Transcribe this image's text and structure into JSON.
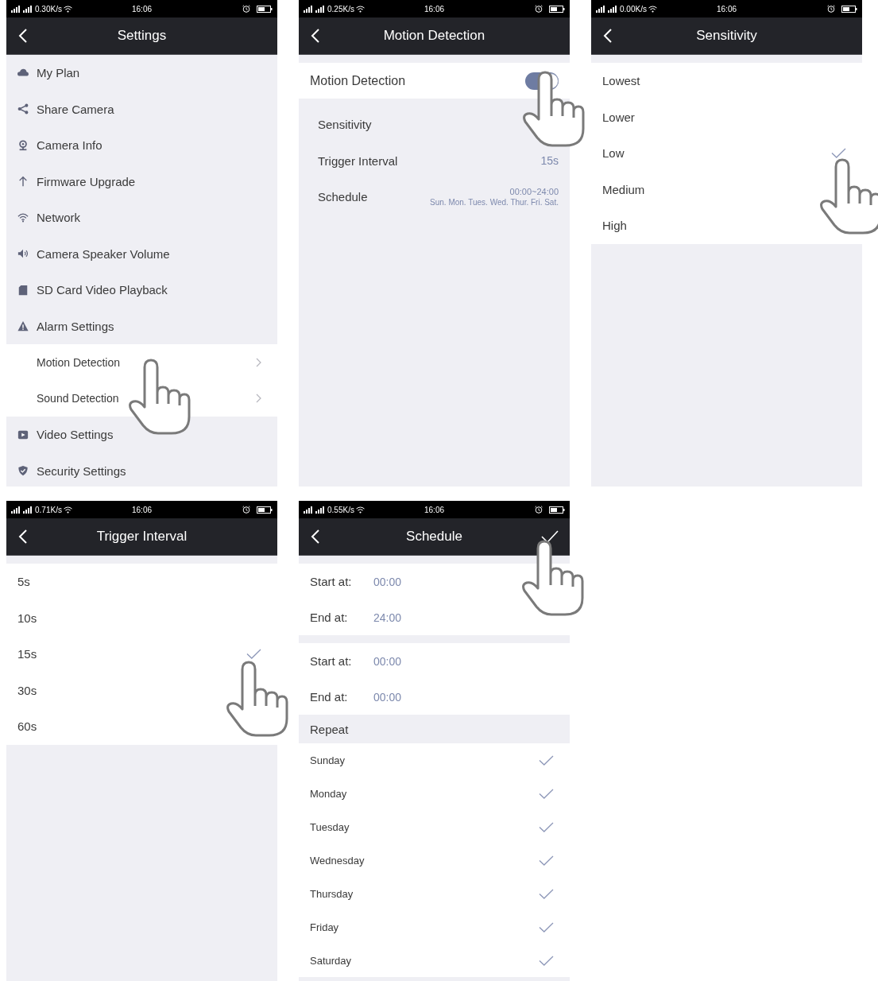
{
  "screens": [
    {
      "kind": "menu",
      "status_bar": {
        "speed": "0.30K/s",
        "time": "16:06"
      },
      "title": "Settings",
      "items": [
        {
          "label": "My Plan"
        },
        {
          "label": "Share Camera"
        },
        {
          "label": "Camera Info"
        },
        {
          "label": "Firmware Upgrade"
        },
        {
          "label": "Network"
        },
        {
          "label": "Camera Speaker Volume"
        },
        {
          "label": "SD Card Video Playback"
        },
        {
          "label": "Alarm Settings",
          "children": [
            {
              "label": "Motion Detection"
            },
            {
              "label": "Sound Detection"
            }
          ]
        },
        {
          "label": "Video Settings"
        },
        {
          "label": "Security Settings"
        }
      ]
    },
    {
      "kind": "detail",
      "status_bar": {
        "speed": "0.25K/s",
        "time": "16:06"
      },
      "title": "Motion Detection",
      "switch": {
        "label": "Motion Detection",
        "on": true
      },
      "rows": [
        {
          "label": "Sensitivity"
        },
        {
          "label": "Trigger Interval",
          "value": "15s"
        },
        {
          "label": "Schedule",
          "value": "00:00~24:00",
          "detail": "Sun. Mon. Tues. Wed. Thur. Fri. Sat."
        }
      ]
    },
    {
      "kind": "options",
      "status_bar": {
        "speed": "0.00K/s",
        "time": "16:06"
      },
      "title": "Sensitivity",
      "options": [
        {
          "label": "Lowest",
          "selected": false
        },
        {
          "label": "Lower",
          "selected": false
        },
        {
          "label": "Low",
          "selected": true
        },
        {
          "label": "Medium",
          "selected": false
        },
        {
          "label": "High",
          "selected": false
        }
      ]
    },
    {
      "kind": "options",
      "status_bar": {
        "speed": "0.71K/s",
        "time": "16:06"
      },
      "title": "Trigger Interval",
      "options": [
        {
          "label": "5s",
          "selected": false
        },
        {
          "label": "10s",
          "selected": false
        },
        {
          "label": "15s",
          "selected": true
        },
        {
          "label": "30s",
          "selected": false
        },
        {
          "label": "60s",
          "selected": false
        }
      ]
    },
    {
      "kind": "schedule",
      "status_bar": {
        "speed": "0.55K/s",
        "time": "16:06"
      },
      "title": "Schedule",
      "periods": [
        {
          "start_label": "Start at:",
          "start": "00:00",
          "end_label": "End at:",
          "end": "24:00"
        },
        {
          "start_label": "Start at:",
          "start": "00:00",
          "end_label": "End at:",
          "end": "00:00"
        }
      ],
      "repeat_title": "Repeat",
      "days": [
        {
          "label": "Sunday",
          "checked": true
        },
        {
          "label": "Monday",
          "checked": true
        },
        {
          "label": "Tuesday",
          "checked": true
        },
        {
          "label": "Wednesday",
          "checked": true
        },
        {
          "label": "Thursday",
          "checked": true
        },
        {
          "label": "Friday",
          "checked": true
        },
        {
          "label": "Saturday",
          "checked": true
        }
      ]
    }
  ]
}
